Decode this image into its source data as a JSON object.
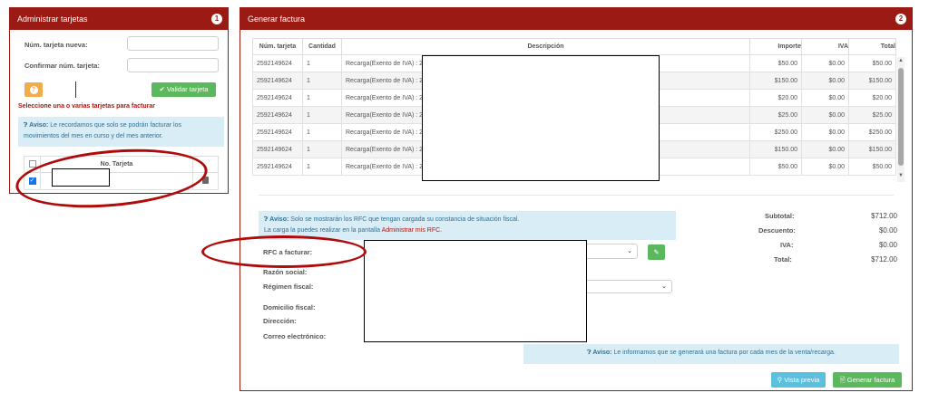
{
  "left_panel": {
    "title": "Administrar tarjetas",
    "badge": "1",
    "new_card_label": "Núm. tarjeta nueva:",
    "confirm_card_label": "Confirmar núm. tarjeta:",
    "help_button": "?",
    "validate_button": "✔ Validar tarjeta",
    "select_heading": "Seleccione una o varias tarjetas para facturar",
    "notice_title": "Aviso:",
    "notice_text": " Le recordamos que solo se podrán facturar los movimientos del mes en curso y del mes anterior.",
    "table_header": "No. Tarjeta",
    "delete_icon": "trash-icon"
  },
  "right_panel": {
    "title": "Generar factura",
    "badge": "2",
    "columns": [
      "Núm. tarjeta",
      "Cantidad",
      "Descripción",
      "Importe",
      "IVA",
      "Total"
    ],
    "rows": [
      [
        "2592149624",
        "1",
        "Recarga(Exento de IVA) : 2",
        "$50.00",
        "$0.00",
        "$50.00"
      ],
      [
        "2592149624",
        "1",
        "Recarga(Exento de IVA) : 2",
        "$150.00",
        "$0.00",
        "$150.00"
      ],
      [
        "2592149624",
        "1",
        "Recarga(Exento de IVA) : 2",
        "$20.00",
        "$0.00",
        "$20.00"
      ],
      [
        "2592149624",
        "1",
        "Recarga(Exento de IVA) : 2",
        "$25.00",
        "$0.00",
        "$25.00"
      ],
      [
        "2592149624",
        "1",
        "Recarga(Exento de IVA) : 2",
        "$250.00",
        "$0.00",
        "$250.00"
      ],
      [
        "2592149624",
        "1",
        "Recarga(Exento de IVA) : 2",
        "$150.00",
        "$0.00",
        "$150.00"
      ],
      [
        "2592149624",
        "1",
        "Recarga(Exento de IVA) : 2",
        "$50.00",
        "$0.00",
        "$50.00"
      ]
    ],
    "rfc_notice_title": "Aviso:",
    "rfc_notice_text": " Solo se mostrarán los RFC que tengan cargada su constancia de situación fiscal.",
    "rfc_notice_line2": "La carga la puedes realizar en la pantalla ",
    "rfc_notice_link": "Administrar mis RFC.",
    "rfc_label": "RFC a facturar:",
    "razon_label": "Razón social:",
    "regimen_label": "Régimen fiscal:",
    "domicilio_label": "Domicilio fiscal:",
    "direccion_label": "Dirección:",
    "correo_label": "Correo electrónico:",
    "totals": {
      "subtotal_label": "Subtotal:",
      "subtotal": "$712.00",
      "descuento_label": "Descuento:",
      "descuento": "$0.00",
      "iva_label": "IVA:",
      "iva": "$0.00",
      "total_label": "Total:",
      "total": "$712.00"
    },
    "invoice_notice_title": "Aviso:",
    "invoice_notice_text": " Le informamos que se generará una factura por cada mes de la venta/recarga.",
    "preview_button": "Vista previa",
    "generate_button": "Generar factura"
  }
}
